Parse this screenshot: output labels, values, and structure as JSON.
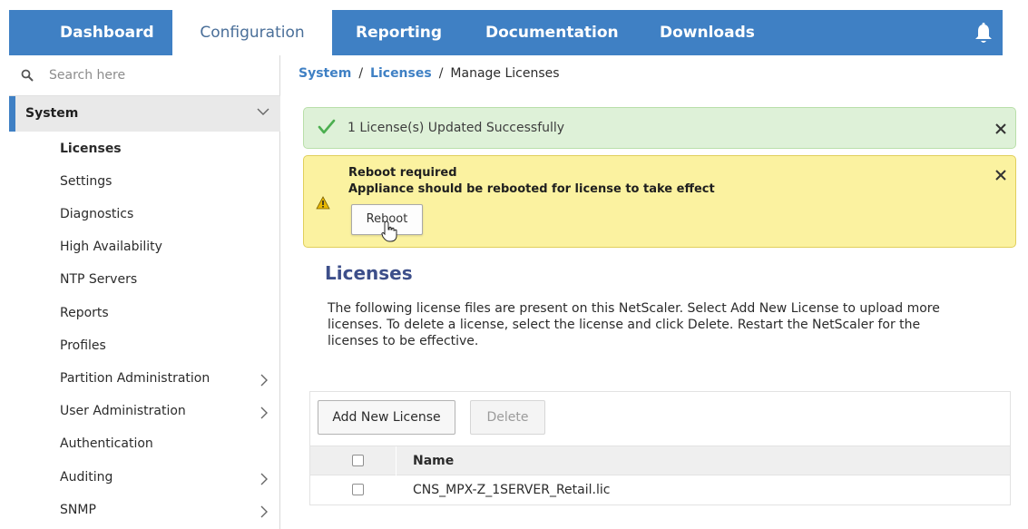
{
  "nav": {
    "tabs": [
      {
        "label": "Dashboard"
      },
      {
        "label": "Configuration"
      },
      {
        "label": "Reporting"
      },
      {
        "label": "Documentation"
      },
      {
        "label": "Downloads"
      }
    ],
    "active_tab": "Configuration",
    "notification_icon": "bell-icon"
  },
  "sidebar": {
    "search": {
      "placeholder": "Search here",
      "icon": "search-icon"
    },
    "section": {
      "label": "System",
      "expanded": true
    },
    "items": [
      {
        "label": "Licenses",
        "selected": true
      },
      {
        "label": "Settings"
      },
      {
        "label": "Diagnostics"
      },
      {
        "label": "High Availability"
      },
      {
        "label": "NTP Servers"
      },
      {
        "label": "Reports"
      },
      {
        "label": "Profiles"
      },
      {
        "label": "Partition Administration",
        "has_children": true
      },
      {
        "label": "User Administration",
        "has_children": true
      },
      {
        "label": "Authentication"
      },
      {
        "label": "Auditing",
        "has_children": true
      },
      {
        "label": "SNMP",
        "has_children": true
      }
    ]
  },
  "breadcrumb": {
    "items": [
      "System",
      "Licenses"
    ],
    "separator": "/",
    "current": "Manage Licenses"
  },
  "alerts": {
    "success": {
      "text": "1 License(s) Updated Successfully"
    },
    "warning": {
      "title": "Reboot required",
      "message": "Appliance should be rebooted for license to take effect",
      "button": "Reboot"
    }
  },
  "licenses": {
    "title": "Licenses",
    "description": "The following license files are present on this NetScaler. Select Add New License to upload more licenses. To delete a license, select the license and click Delete. Restart the NetScaler for the licenses to be effective.",
    "buttons": {
      "add": "Add New License",
      "delete": "Delete"
    },
    "table": {
      "columns": [
        "Name"
      ],
      "rows": [
        {
          "name": "CNS_MPX-Z_1SERVER_Retail.lic",
          "checked": false
        }
      ]
    }
  },
  "colors": {
    "nav_bg": "#3f80c4",
    "success_bg": "#def1d8",
    "warning_bg": "#fbf2a0",
    "title_color": "#3d4f8a"
  }
}
